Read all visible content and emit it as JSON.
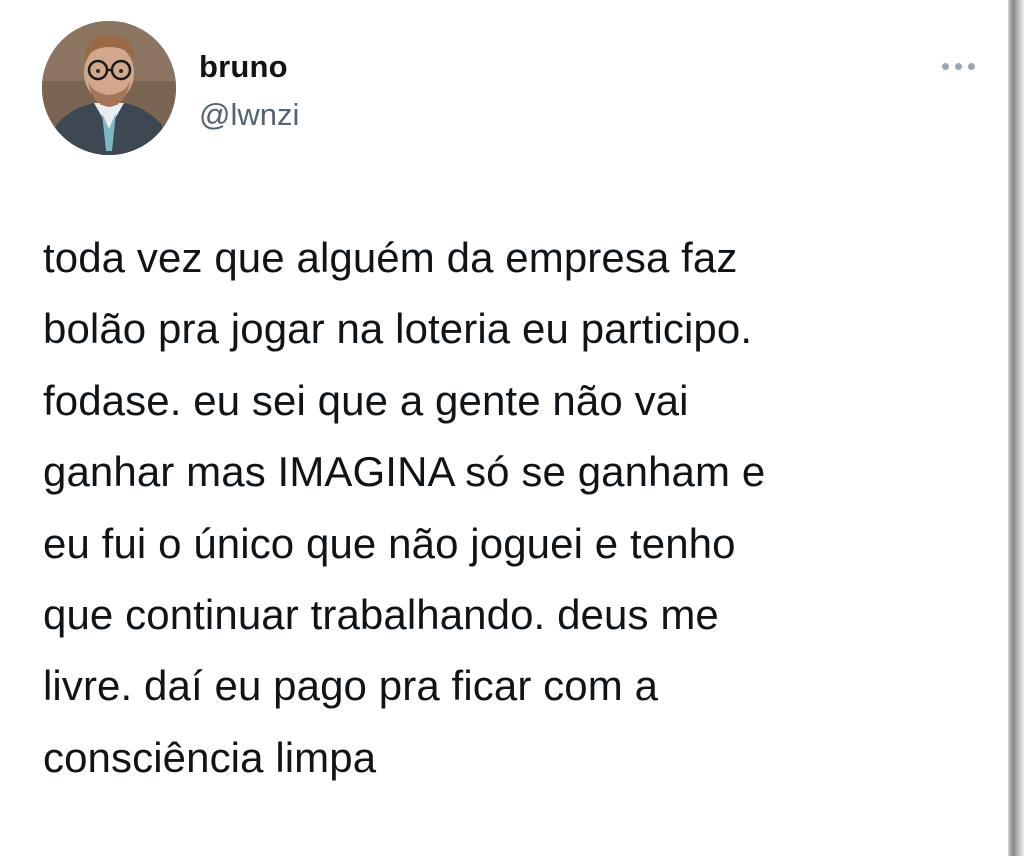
{
  "author": {
    "display_name": "bruno",
    "handle": "@lwnzi",
    "avatar_icon": "profile-photo"
  },
  "more_menu": {
    "icon": "more-horizontal-icon"
  },
  "tweet": {
    "lines": [
      "toda vez que alguém da empresa faz",
      "bolão pra jogar na loteria eu participo.",
      "fodase. eu sei que a gente não vai",
      "ganhar mas IMAGINA só se ganham e",
      "eu fui o único que não joguei e tenho",
      "que continuar trabalhando. deus me",
      "livre. daí eu pago pra ficar com a",
      "consciência limpa"
    ]
  },
  "colors": {
    "text_primary": "#0f1419",
    "text_secondary": "#536471",
    "background": "#ffffff"
  }
}
